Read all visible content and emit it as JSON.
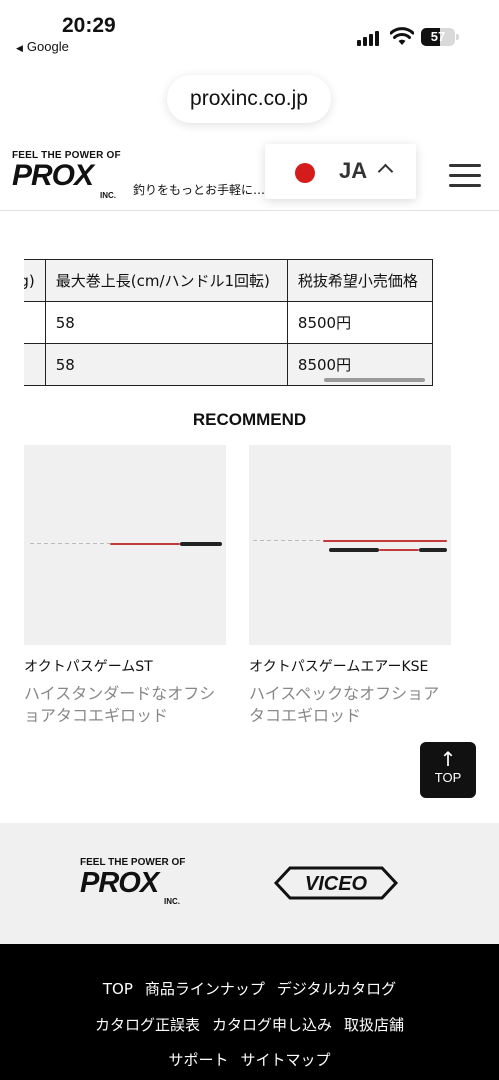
{
  "status_bar": {
    "time": "20:29",
    "back_app": "Google",
    "battery_percent": 57
  },
  "browser": {
    "url": "proxinc.co.jp"
  },
  "header": {
    "logo_tagline": "FEEL THE POWER OF",
    "logo_word": "PROX",
    "logo_inc": "INC.",
    "site_tagline": "釣りをもっとお手軽に…",
    "language": {
      "code": "JA",
      "flag_color": "#d41c1c"
    }
  },
  "spec_table": {
    "headers": [
      "(kg)",
      "最大巻上長(cm/ハンドル1回転)",
      "税抜希望小売価格"
    ],
    "rows": [
      [
        "",
        "58",
        "8500円"
      ],
      [
        "",
        "58",
        "8500円"
      ]
    ]
  },
  "recommend": {
    "title": "RECOMMEND",
    "items": [
      {
        "name": "オクトパスゲームST",
        "description": "ハイスタンダードなオフショアタコエギロッド"
      },
      {
        "name": "オクトパスゲームエアーKSE",
        "description": "ハイスペックなオフショアタコエギロッド"
      }
    ]
  },
  "top_button": {
    "label": "TOP"
  },
  "brands": {
    "prox": {
      "tagline": "FEEL THE POWER OF",
      "word": "PROX",
      "inc": "INC."
    },
    "viceo": {
      "word": "VICEO"
    }
  },
  "footer": {
    "rows": [
      [
        "TOP",
        "商品ラインナップ",
        "デジタルカタログ"
      ],
      [
        "カタログ正誤表",
        "カタログ申し込み",
        "取扱店舗"
      ],
      [
        "サポート",
        "サイトマップ"
      ]
    ]
  },
  "colors": {
    "accent_red": "#d41c1c",
    "footer_bg": "#000000",
    "band_bg": "#f0f0f0"
  }
}
